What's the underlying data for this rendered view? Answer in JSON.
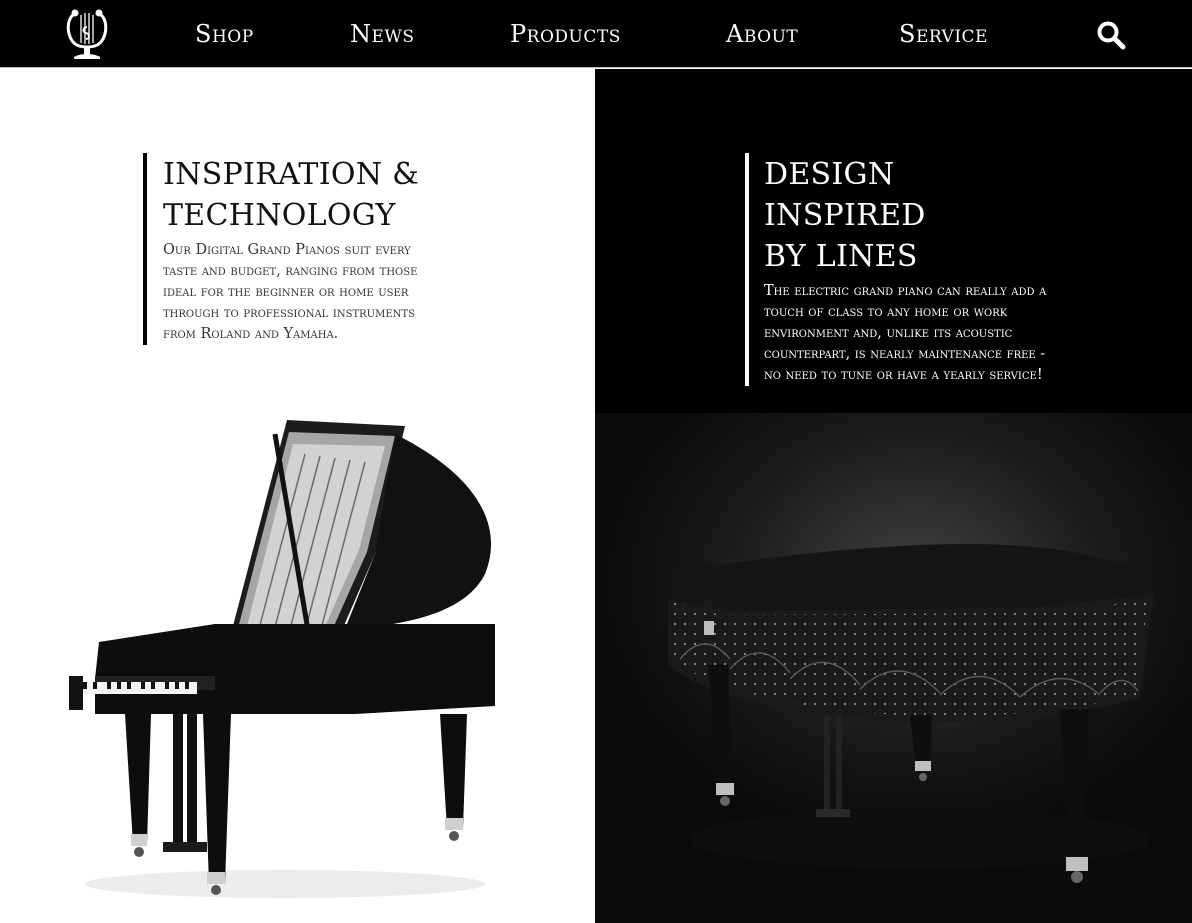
{
  "nav": {
    "logo_icon": "lyre-logo-icon",
    "items": [
      {
        "label": "Shop"
      },
      {
        "label": "News"
      },
      {
        "label": "Products"
      },
      {
        "label": "About"
      },
      {
        "label": "Service"
      }
    ],
    "search_icon": "search-icon"
  },
  "features": {
    "left": {
      "title_line1": "INSPIRATION &",
      "title_line2": "TECHNOLOGY",
      "text": "Our Digital Grand Pianos suit every taste and budget, ranging from those ideal for the beginner or home user through to professional instruments from Roland and Yamaha.",
      "image": "white-background-grand-piano"
    },
    "right": {
      "title_line1": "DESIGN INSPIRED",
      "title_line2": "BY LINES",
      "text": "The electric grand piano can really add a touch of class to any home or work environment and, unlike its acoustic counterpart, is nearly maintenance free - no need to tune or have a yearly service!",
      "image": "black-studded-grand-piano"
    }
  },
  "colors": {
    "nav_bg": "#000000",
    "nav_text": "#ffffff",
    "left_panel": "#ffffff",
    "right_panel": "#000000"
  }
}
